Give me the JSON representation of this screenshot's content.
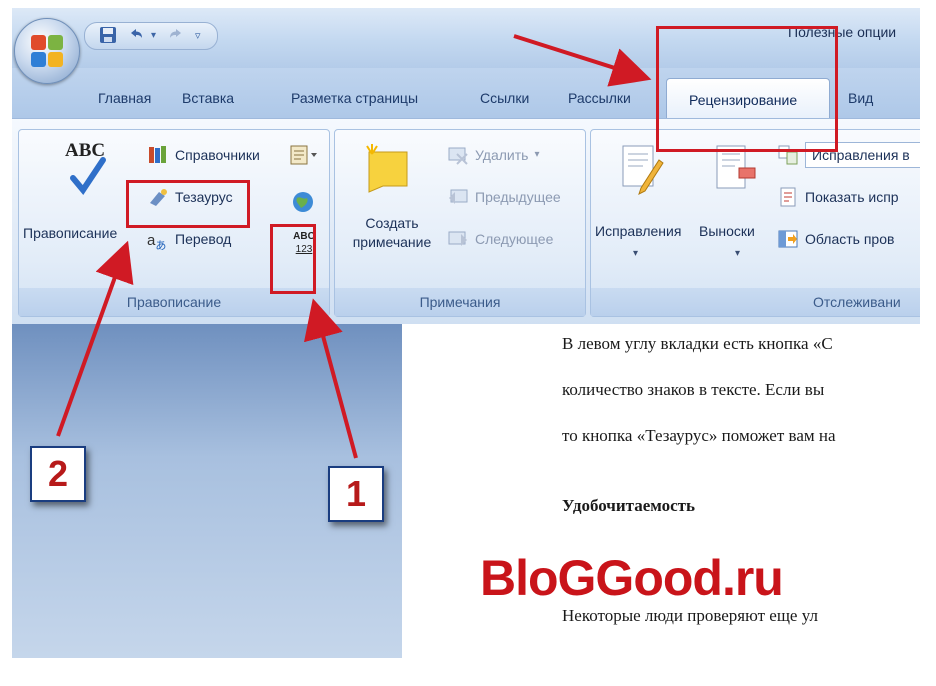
{
  "title_bar": {
    "document_title": "Полезные опции"
  },
  "tabs": [
    {
      "label": "Главная"
    },
    {
      "label": "Вставка"
    },
    {
      "label": "Разметка страницы"
    },
    {
      "label": "Ссылки"
    },
    {
      "label": "Рассылки"
    },
    {
      "label": "Рецензирование",
      "active": true
    },
    {
      "label": "Вид"
    }
  ],
  "ribbon": {
    "proofing": {
      "label": "Правописание",
      "spelling_button": "Правописание",
      "spelling_icon_text": "ABC",
      "research_button": "Справочники",
      "thesaurus_button": "Тезаурус",
      "translate_button": "Перевод",
      "word_count_icon_top": "ABC",
      "word_count_icon_bottom": "123"
    },
    "comments": {
      "label": "Примечания",
      "new_comment_line1": "Создать",
      "new_comment_line2": "примечание",
      "delete_button": "Удалить",
      "previous_button": "Предыдущее",
      "next_button": "Следующее"
    },
    "tracking": {
      "label": "Отслеживани",
      "track_changes_button": "Исправления",
      "balloons_button": "Выноски",
      "markup_dropdown": "Исправления в",
      "show_markup_button": "Показать испр",
      "reviewing_pane_button": "Область пров"
    }
  },
  "document": {
    "lines": [
      "В левом углу вкладки есть кнопка «С",
      "количество знаков в тексте. Если вы",
      "то кнопка «Тезаурус» поможет вам на",
      "Удобочитаемость",
      "Некоторые люди проверяют еще ул"
    ]
  },
  "watermark": "BloGGood.ru",
  "callouts": {
    "one": "1",
    "two": "2"
  },
  "colors": {
    "annotation_red": "#d01a24",
    "watermark_red": "#c9141a",
    "callout_border": "#1a3d80"
  }
}
